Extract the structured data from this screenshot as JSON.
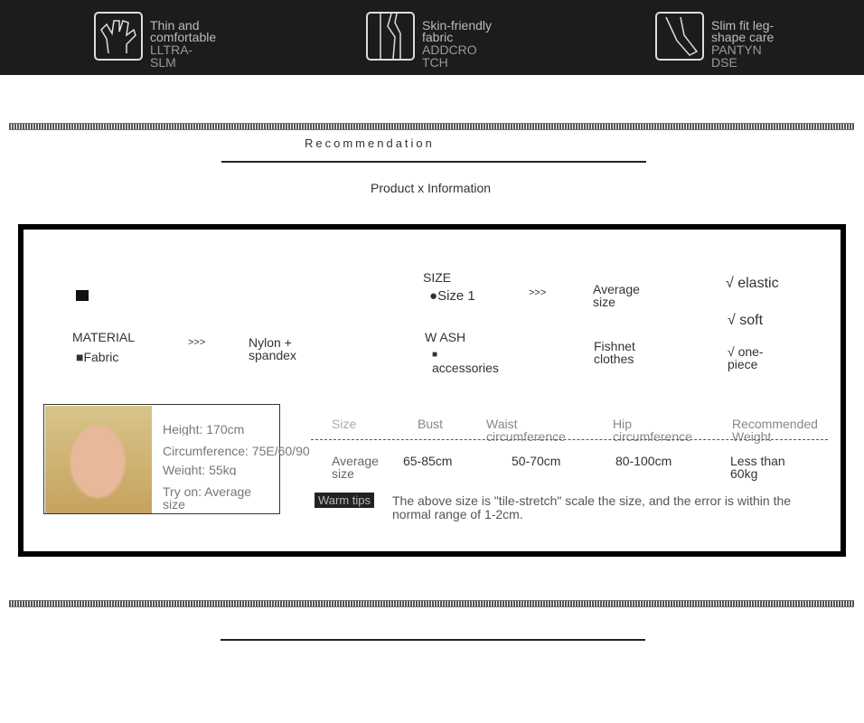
{
  "features": [
    {
      "icon": "hand-icon",
      "title": "Thin and comfortable",
      "sub": "LLTRA-SLM"
    },
    {
      "icon": "leg-icon",
      "title": "Skin-friendly fabric",
      "sub": "ADDCRO TCH"
    },
    {
      "icon": "stocking-icon",
      "title": "Slim fit leg-shape care",
      "sub": "PANTYN DSE"
    }
  ],
  "heading": "Recommendation",
  "subheading": "Product x Information",
  "info": {
    "material_label": "MATERIAL",
    "material_sub": "Fabric",
    "arrow": ">>>",
    "material_value": "Nylon + spandex",
    "size_label": "SIZE",
    "size_sub": "Size 1",
    "size_value": "Average size",
    "wash_label": "W ASH",
    "wash_sub": "accessories",
    "wash_value": "Fishnet clothes",
    "features": [
      "√ elastic",
      "√ soft",
      "√ one-piece"
    ]
  },
  "model": {
    "height": "Height: 170cm",
    "circumference": "Circumference: 75E/60/90",
    "weight": "Weight: 55kg",
    "try_on": "Try on: Average size"
  },
  "table": {
    "headers": [
      "Size",
      "Bust",
      "Waist circumference",
      "Hip circumference",
      "Recommended Weight"
    ],
    "row": [
      "Average size",
      "65-85cm",
      "50-70cm",
      "80-100cm",
      "Less than 60kg"
    ]
  },
  "tips": {
    "label": "Warm tips",
    "text": "The above size is \"tile-stretch\" scale the size, and the error is within the normal range of 1-2cm."
  }
}
